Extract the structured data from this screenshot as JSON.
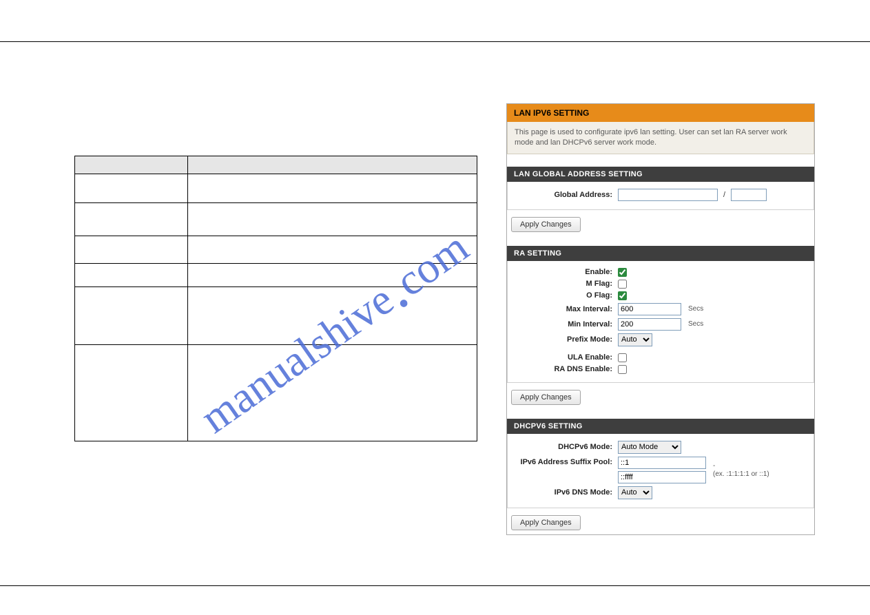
{
  "watermark": "manualshive com",
  "panel": {
    "title": "LAN IPV6 SETTING",
    "description": "This page is used to configurate ipv6 lan setting. User can set lan RA server work mode and lan DHCPv6 server work mode.",
    "global": {
      "heading": "LAN GLOBAL ADDRESS SETTING",
      "label": "Global Address:",
      "value": "",
      "prefix": "",
      "sep": "/",
      "apply": "Apply Changes"
    },
    "ra": {
      "heading": "RA SETTING",
      "enable_label": "Enable:",
      "enable": true,
      "mflag_label": "M Flag:",
      "mflag": false,
      "oflag_label": "O Flag:",
      "oflag": true,
      "maxint_label": "Max Interval:",
      "maxint": "600",
      "minint_label": "Min Interval:",
      "minint": "200",
      "int_unit": "Secs",
      "prefix_label": "Prefix Mode:",
      "prefix_value": "Auto",
      "ula_label": "ULA Enable:",
      "ula": false,
      "radns_label": "RA DNS Enable:",
      "radns": false,
      "apply": "Apply Changes"
    },
    "dhcp": {
      "heading": "DHCPV6 SETTING",
      "mode_label": "DHCPv6 Mode:",
      "mode_value": "Auto Mode",
      "suffix_label": "IPv6 Address Suffix Pool:",
      "suffix_start": "::1",
      "suffix_dash": "-",
      "suffix_end": "::ffff",
      "suffix_hint": "(ex. :1:1:1:1 or ::1)",
      "dns_label": "IPv6 DNS Mode:",
      "dns_value": "Auto",
      "apply": "Apply Changes"
    }
  },
  "blank_table_rows": 6
}
